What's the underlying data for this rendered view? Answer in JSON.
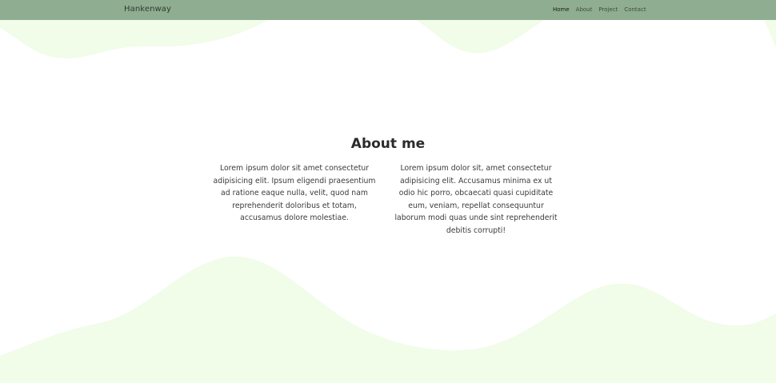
{
  "navbar": {
    "brand": "Hankenway",
    "links": [
      {
        "label": "Home",
        "active": true
      },
      {
        "label": "About",
        "active": false
      },
      {
        "label": "Project",
        "active": false
      },
      {
        "label": "Contact",
        "active": false
      }
    ]
  },
  "about": {
    "title": "About me",
    "columns": [
      "Lorem ipsum dolor sit amet consectetur adipisicing elit. Ipsum eligendi praesentium ad ratione eaque nulla, velit, quod nam reprehenderit doloribus et totam, accusamus dolore molestiae.",
      "Lorem ipsum dolor sit, amet consectetur adipisicing elit. Accusamus minima ex ut odio hic porro, obcaecati quasi cupiditate eum, veniam, repellat consequuntur laborum modi quas unde sint reprehenderit debitis corrupti!"
    ]
  },
  "colors": {
    "navbar": "#8fad91",
    "wave": "#f1fce9",
    "background": "#ffffff"
  }
}
